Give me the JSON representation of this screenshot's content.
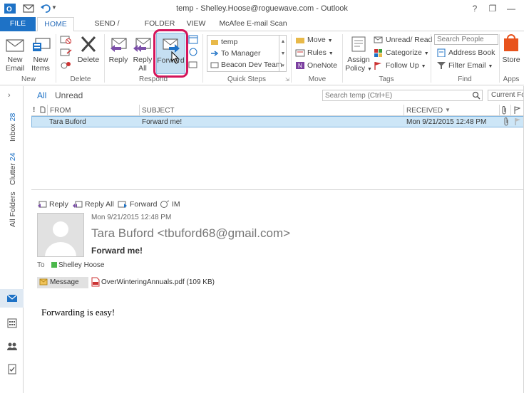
{
  "window": {
    "title": "temp - Shelley.Hoose@roguewave.com - Outlook",
    "help": "?",
    "restore": "❐",
    "minimize": "—",
    "maximize": "☐"
  },
  "tabs": [
    "FILE",
    "HOME",
    "SEND / RECEIVE",
    "FOLDER",
    "VIEW",
    "McAfee E-mail Scan"
  ],
  "ribbon": {
    "new": {
      "new_email": [
        "New",
        "Email"
      ],
      "new_items": [
        "New",
        "Items"
      ],
      "label": "New"
    },
    "delete": {
      "delete": "Delete",
      "label": "Delete"
    },
    "respond": {
      "reply": "Reply",
      "reply_all": [
        "Reply",
        "All"
      ],
      "forward": "Forward",
      "label": "Respond"
    },
    "quick_steps": {
      "items": [
        "temp",
        "To Manager",
        "Beacon Dev Team"
      ],
      "label": "Quick Steps"
    },
    "move": {
      "move": "Move",
      "rules": "Rules",
      "onenote": "OneNote",
      "label": "Move"
    },
    "tags": {
      "assign_policy": [
        "Assign",
        "Policy"
      ],
      "unread_read": "Unread/ Read",
      "categorize": "Categorize",
      "follow_up": "Follow Up",
      "label": "Tags"
    },
    "find": {
      "search_people_placeholder": "Search People",
      "address_book": "Address Book",
      "filter_email": "Filter Email",
      "label": "Find"
    },
    "apps": {
      "store": "Store",
      "label": "Apps"
    }
  },
  "nav": {
    "inbox": "Inbox",
    "inbox_count": "28",
    "clutter": "Clutter",
    "clutter_count": "24",
    "all_folders": "All Folders"
  },
  "filter": {
    "all": "All",
    "unread": "Unread"
  },
  "search": {
    "placeholder": "Search temp (Ctrl+E)",
    "scope": "Current Fo"
  },
  "list": {
    "columns": {
      "importance": "!",
      "from": "FROM",
      "subject": "SUBJECT",
      "received": "RECEIVED"
    },
    "rows": [
      {
        "from": "Tara Buford",
        "subject": "Forward me!",
        "received": "Mon 9/21/2015 12:48 PM"
      }
    ]
  },
  "reading": {
    "actions": {
      "reply": "Reply",
      "reply_all": "Reply All",
      "forward": "Forward",
      "im": "IM"
    },
    "date": "Mon 9/21/2015 12:48 PM",
    "sender": "Tara Buford <tbuford68@gmail.com>",
    "subject": "Forward me!",
    "to_label": "To",
    "to": "Shelley Hoose",
    "message_tab": "Message",
    "attachment": "OverWinteringAnnuals.pdf (109 KB)",
    "body": "Forwarding is easy!"
  },
  "colors": {
    "accent": "#1e72c6",
    "highlight": "#cde6f7",
    "callout": "#d4145a"
  }
}
